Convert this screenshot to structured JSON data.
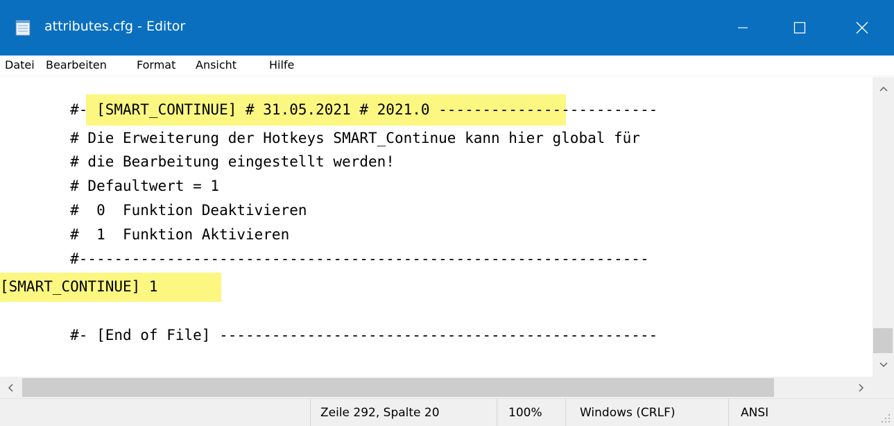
{
  "window": {
    "title": "attributes.cfg - Editor",
    "accent_color": "#0a6fbf",
    "icons": [
      "notepad-icon",
      "minimize-icon",
      "maximize-icon",
      "close-icon"
    ]
  },
  "menu": {
    "items": [
      "Datei",
      "Bearbeiten",
      "Format",
      "Ansicht",
      "Hilfe"
    ]
  },
  "editor": {
    "highlight_color": "#fbf781",
    "lines": [
      "        #- [SMART_CONTINUE] # 31.05.2021 # 2021.0 -------------------------",
      "        # Die Erweiterung der Hotkeys SMART_Continue kann hier global für",
      "        # die Bearbeitung eingestellt werden!",
      "        # Defaultwert = 1",
      "        #  0  Funktion Deaktivieren",
      "        #  1  Funktion Aktivieren",
      "        #-----------------------------------------------------------------",
      "[SMART_CONTINUE] 1",
      "",
      "        #- [End of File] --------------------------------------------------"
    ]
  },
  "statusbar": {
    "position": "Zeile 292, Spalte 20",
    "zoom": "100%",
    "line_ending": "Windows (CRLF)",
    "encoding": "ANSI"
  }
}
